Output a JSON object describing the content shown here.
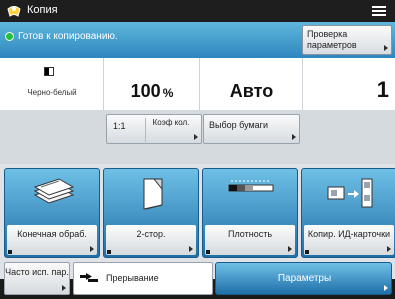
{
  "app": {
    "title": "Копия",
    "icon": "copy-app-icon"
  },
  "status": {
    "text": "Готов к копированию.",
    "check_button": "Проверка параметров"
  },
  "settings": {
    "color_mode": "Черно-белый",
    "zoom_value": "100",
    "zoom_unit": "%",
    "paper_value": "Авто",
    "copies": "1"
  },
  "controls": {
    "ratio_label": "1:1",
    "coef_label": "Коэф кол.",
    "paper_select_label": "Выбор бумаги"
  },
  "function_buttons": [
    {
      "label": "Конечная обраб.",
      "icon": "finishing-icon"
    },
    {
      "label": "2-стор.",
      "icon": "two-sided-icon"
    },
    {
      "label": "Плотность",
      "icon": "density-icon"
    },
    {
      "label": "Копир. ИД-карточки",
      "icon": "id-card-copy-icon"
    }
  ],
  "bottom": {
    "frequent_label": "Часто исп. пар.",
    "interrupt_label": "Прерывание",
    "params_label": "Параметры"
  },
  "colors": {
    "accent_blue": "#2e86be",
    "ready_green": "#22c13a"
  }
}
